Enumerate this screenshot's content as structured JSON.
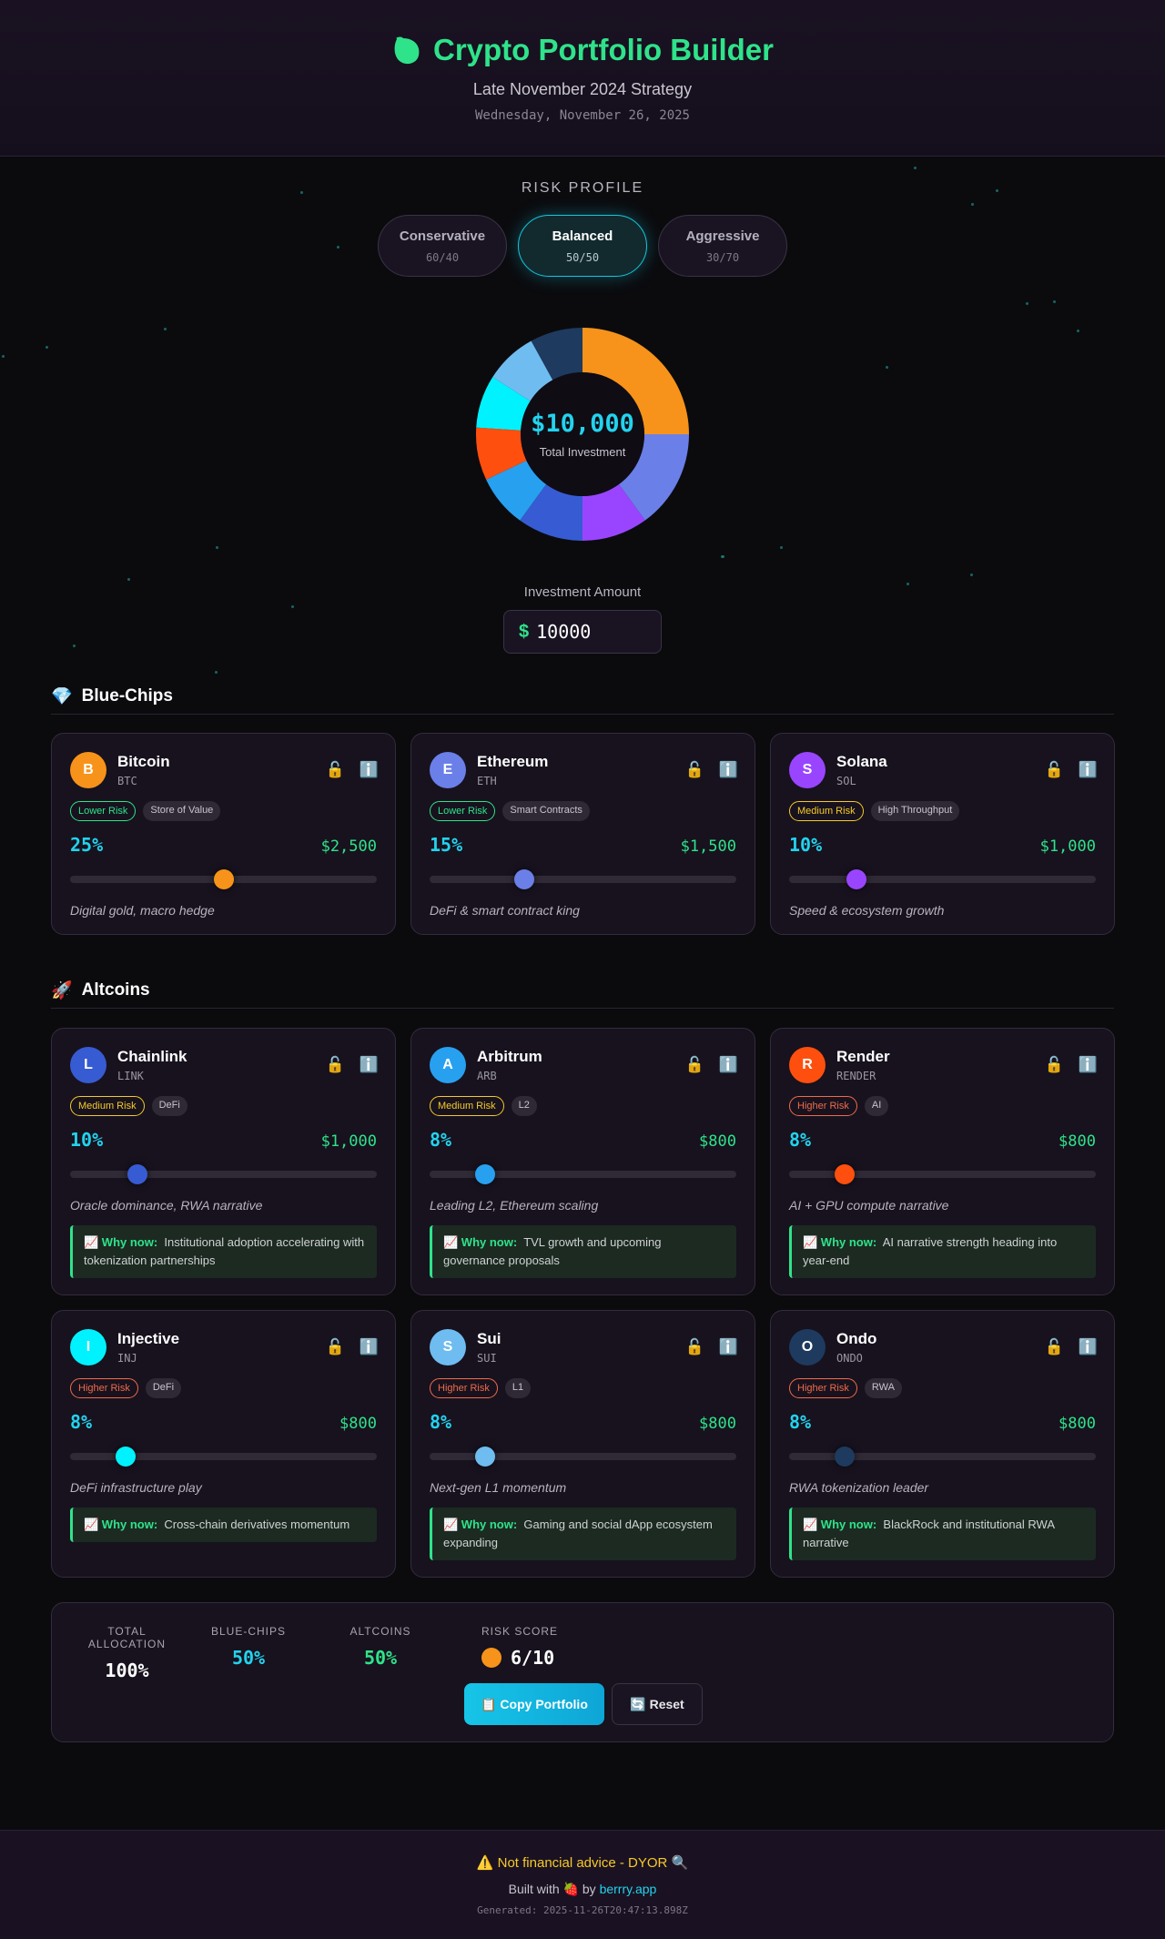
{
  "header": {
    "title": "Crypto Portfolio Builder",
    "subtitle": "Late November 2024 Strategy",
    "date": "Wednesday, November 26, 2025"
  },
  "risk": {
    "title": "RISK PROFILE",
    "options": [
      {
        "label": "Conservative",
        "ratio": "60/40"
      },
      {
        "label": "Balanced",
        "ratio": "50/50",
        "active": true
      },
      {
        "label": "Aggressive",
        "ratio": "30/70"
      }
    ]
  },
  "donut": {
    "amount": "$10,000",
    "caption": "Total Investment",
    "slices": [
      {
        "name": "Bitcoin",
        "pct": 25,
        "color": "#f7931a"
      },
      {
        "name": "Ethereum",
        "pct": 15,
        "color": "#6b7fe8"
      },
      {
        "name": "Solana",
        "pct": 10,
        "color": "#9945ff"
      },
      {
        "name": "Chainlink",
        "pct": 10,
        "color": "#375bd2"
      },
      {
        "name": "Arbitrum",
        "pct": 8,
        "color": "#28a0f0"
      },
      {
        "name": "Render",
        "pct": 8,
        "color": "#ff4f0f"
      },
      {
        "name": "Injective",
        "pct": 8,
        "color": "#00f2fe"
      },
      {
        "name": "Sui",
        "pct": 8,
        "color": "#6fbcf0"
      },
      {
        "name": "Ondo",
        "pct": 8,
        "color": "#1e3a5f"
      }
    ]
  },
  "investment": {
    "label": "Investment Amount",
    "currency": "$",
    "value": "10000"
  },
  "sections": {
    "bluechips": {
      "icon": "💎",
      "title": "Blue-Chips"
    },
    "altcoins": {
      "icon": "🚀",
      "title": "Altcoins"
    }
  },
  "bluechips": [
    {
      "letter": "B",
      "name": "Bitcoin",
      "symbol": "BTC",
      "color": "#f7931a",
      "risk": "Lower Risk",
      "risk_level": "low",
      "category": "Store of Value",
      "pct": "25%",
      "usd": "$2,500",
      "slider": 0.5,
      "desc": "Digital gold, macro hedge"
    },
    {
      "letter": "E",
      "name": "Ethereum",
      "symbol": "ETH",
      "color": "#6b7fe8",
      "risk": "Lower Risk",
      "risk_level": "low",
      "category": "Smart Contracts",
      "pct": "15%",
      "usd": "$1,500",
      "slider": 0.31,
      "desc": "DeFi & smart contract king"
    },
    {
      "letter": "S",
      "name": "Solana",
      "symbol": "SOL",
      "color": "#9945ff",
      "risk": "Medium Risk",
      "risk_level": "med",
      "category": "High Throughput",
      "pct": "10%",
      "usd": "$1,000",
      "slider": 0.22,
      "desc": "Speed & ecosystem growth"
    }
  ],
  "altcoins": [
    {
      "letter": "L",
      "name": "Chainlink",
      "symbol": "LINK",
      "color": "#375bd2",
      "risk": "Medium Risk",
      "risk_level": "med",
      "category": "DeFi",
      "pct": "10%",
      "usd": "$1,000",
      "slider": 0.22,
      "desc": "Oracle dominance, RWA narrative",
      "why": "Institutional adoption accelerating with tokenization partnerships"
    },
    {
      "letter": "A",
      "name": "Arbitrum",
      "symbol": "ARB",
      "color": "#28a0f0",
      "risk": "Medium Risk",
      "risk_level": "med",
      "category": "L2",
      "pct": "8%",
      "usd": "$800",
      "slider": 0.18,
      "desc": "Leading L2, Ethereum scaling",
      "why": "TVL growth and upcoming governance proposals"
    },
    {
      "letter": "R",
      "name": "Render",
      "symbol": "RENDER",
      "color": "#ff4f0f",
      "risk": "Higher Risk",
      "risk_level": "high",
      "category": "AI",
      "pct": "8%",
      "usd": "$800",
      "slider": 0.18,
      "desc": "AI + GPU compute narrative",
      "why": "AI narrative strength heading into year-end"
    },
    {
      "letter": "I",
      "name": "Injective",
      "symbol": "INJ",
      "color": "#00f2fe",
      "risk": "Higher Risk",
      "risk_level": "high",
      "category": "DeFi",
      "pct": "8%",
      "usd": "$800",
      "slider": 0.18,
      "desc": "DeFi infrastructure play",
      "why": "Cross-chain derivatives momentum"
    },
    {
      "letter": "S",
      "name": "Sui",
      "symbol": "SUI",
      "color": "#6fbcf0",
      "risk": "Higher Risk",
      "risk_level": "high",
      "category": "L1",
      "pct": "8%",
      "usd": "$800",
      "slider": 0.18,
      "desc": "Next-gen L1 momentum",
      "why": "Gaming and social dApp ecosystem expanding"
    },
    {
      "letter": "O",
      "name": "Ondo",
      "symbol": "ONDO",
      "color": "#1e3a5f",
      "risk": "Higher Risk",
      "risk_level": "high",
      "category": "RWA",
      "pct": "8%",
      "usd": "$800",
      "slider": 0.18,
      "desc": "RWA tokenization leader",
      "why": "BlackRock and institutional RWA narrative"
    }
  ],
  "why_label": "📈 Why now:",
  "summary": {
    "total_label": "TOTAL ALLOCATION",
    "total_value": "100%",
    "blue_label": "BLUE-CHIPS",
    "blue_value": "50%",
    "alt_label": "ALTCOINS",
    "alt_value": "50%",
    "risk_label": "RISK SCORE",
    "risk_value": "6/10",
    "copy_label": "📋 Copy Portfolio",
    "reset_label": "🔄 Reset"
  },
  "footer": {
    "disclaimer": "⚠️ Not financial advice - DYOR 🔍",
    "built_prefix": "Built with 🍓 by",
    "built_link": "berrry.app",
    "generated": "Generated: 2025-11-26T20:47:13.898Z"
  },
  "colors": {
    "accent": "#22d3ee",
    "green": "#2fe38a",
    "yellow": "#f7c928",
    "red": "#f26a4a"
  }
}
